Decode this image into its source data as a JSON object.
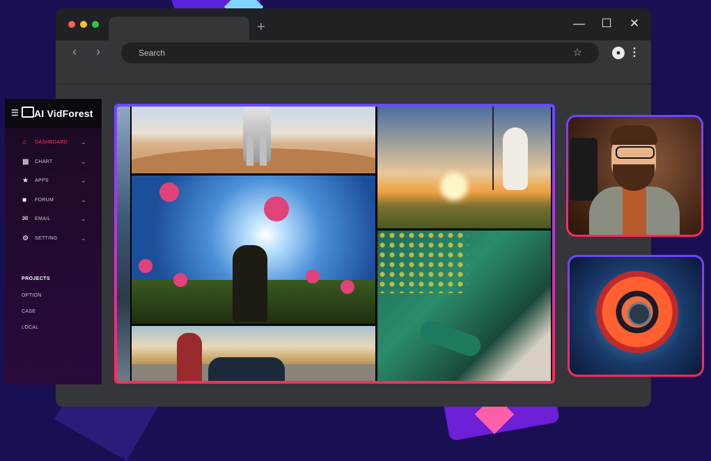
{
  "browser": {
    "search_placeholder": "Search",
    "new_tab_glyph": "+",
    "colors": {
      "dot_red": "#ff5f57",
      "dot_yellow": "#febc2e",
      "dot_green": "#28c840"
    }
  },
  "sidebar": {
    "brand": "AI VidForest",
    "menu": [
      {
        "icon": "home-icon",
        "label": "DASHBOARD",
        "active": true
      },
      {
        "icon": "chart-icon",
        "label": "CHART"
      },
      {
        "icon": "star-icon",
        "label": "APPS"
      },
      {
        "icon": "chat-icon",
        "label": "FORUM"
      },
      {
        "icon": "email-icon",
        "label": "EMAIL"
      },
      {
        "icon": "gear-icon",
        "label": "SETTING"
      }
    ],
    "section_title": "PROJECTS",
    "projects": [
      "OPTION",
      "CASE",
      "LOCAL"
    ],
    "accent": "#ff3a6a"
  }
}
